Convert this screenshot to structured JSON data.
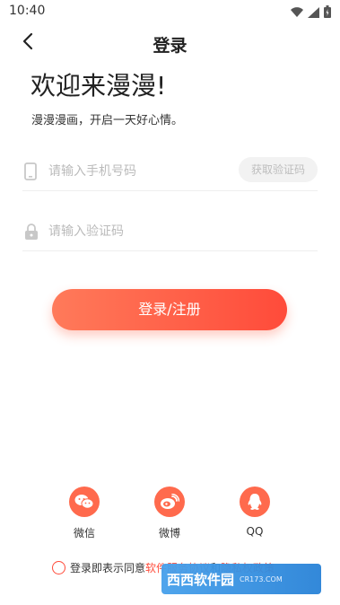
{
  "status": {
    "time": "10:40"
  },
  "nav": {
    "title": "登录",
    "back_icon": "chevron-left-icon"
  },
  "welcome": {
    "title": "欢迎来漫漫!",
    "subtitle": "漫漫漫画，开启一天好心情。"
  },
  "phone": {
    "placeholder": "请输入手机号码",
    "value": "",
    "icon": "phone-icon",
    "code_button": "获取验证码"
  },
  "code": {
    "placeholder": "请输入验证码",
    "value": "",
    "icon": "lock-icon"
  },
  "login_button": "登录/注册",
  "social": [
    {
      "label": "微信",
      "icon": "wechat-icon"
    },
    {
      "label": "微博",
      "icon": "weibo-icon"
    },
    {
      "label": "QQ",
      "icon": "qq-icon"
    }
  ],
  "agreement": {
    "prefix": "登录即表示同意",
    "link1": "软件服务协议",
    "middle": "和",
    "link2": "隐私权政策"
  },
  "watermark": {
    "logo": "西西软件园",
    "sub": "CR173.COM"
  },
  "colors": {
    "accent": "#ff4b3a",
    "accent_light": "#ff7a5a",
    "social": "#ff6a4d"
  }
}
